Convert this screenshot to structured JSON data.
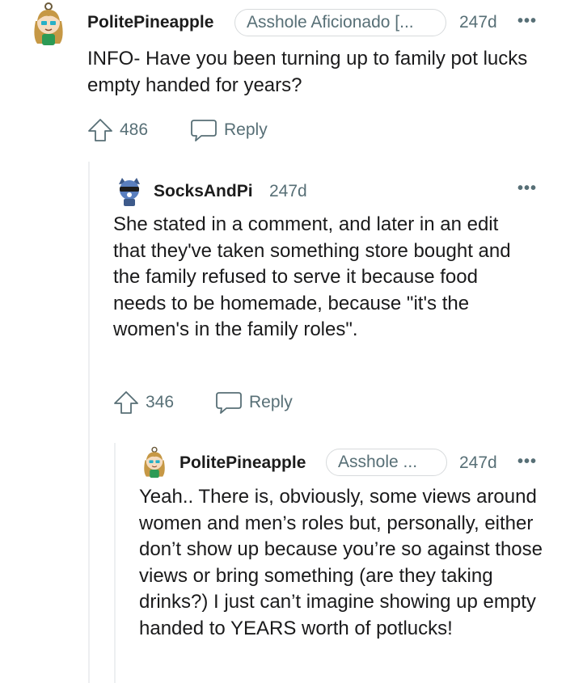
{
  "comments": [
    {
      "username": "PolitePineapple",
      "flair": "Asshole Aficionado [...",
      "age": "247d",
      "more": "•••",
      "text": "INFO- Have you been turning up to family pot lucks empty handed for years?",
      "votes": "486",
      "reply_label": "Reply"
    },
    {
      "username": "SocksAndPi",
      "age": "247d",
      "more": "•••",
      "text": "She stated in a comment, and later in an edit that they've taken something store bought and the family refused to serve it because food needs to be homemade, because \"it's the women's in the family roles\".",
      "votes": "346",
      "reply_label": "Reply"
    },
    {
      "username": "PolitePineapple",
      "flair": "Asshole ...",
      "age": "247d",
      "more": "•••",
      "text": "Yeah.. There is, obviously, some views around women and men’s roles but, personally, either don’t show up because you’re so against those views or bring something (are they taking drinks?) I just can’t imagine showing up empty handed to YEARS worth of potlucks!"
    }
  ],
  "colors": {
    "text": "#1a1a1b",
    "meta": "#576f76",
    "thread_line": "#edeff1",
    "flair_border": "#d7dadc"
  },
  "icons": {
    "avatar_1": "pineapple-girl-avatar-icon",
    "avatar_2": "raccoon-sunglasses-avatar-icon",
    "upvote": "upvote-arrow-icon",
    "reply": "speech-bubble-icon"
  }
}
